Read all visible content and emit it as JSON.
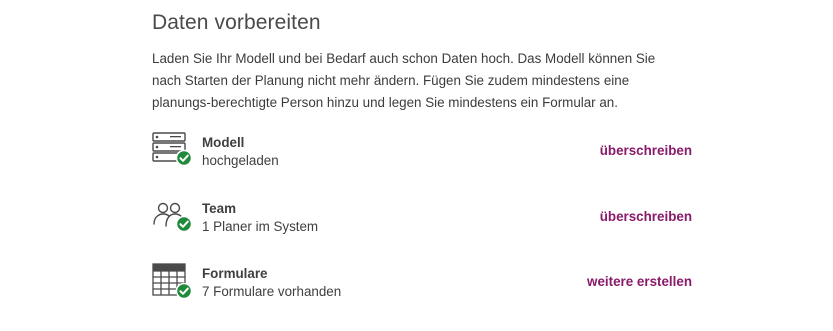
{
  "section": {
    "title": "Daten vorbereiten",
    "description": "Laden Sie Ihr Modell und bei Bedarf auch schon Daten hoch. Das Modell können Sie nach Starten der Planung nicht mehr ändern. Fügen Sie zudem mindestens eine planungs-berechtigte Person hinzu und legen Sie mindestens ein Formular an."
  },
  "rows": [
    {
      "icon": "server-icon",
      "status_icon": "check-icon",
      "title": "Modell",
      "subtitle": "hochgeladen",
      "action": "überschreiben"
    },
    {
      "icon": "team-icon",
      "status_icon": "check-icon",
      "title": "Team",
      "subtitle": "1 Planer im System",
      "action": "überschreiben"
    },
    {
      "icon": "table-icon",
      "status_icon": "check-icon",
      "title": "Formulare",
      "subtitle": "7 Formulare vorhanden",
      "action": "weitere erstellen"
    }
  ],
  "colors": {
    "accent": "#8a1a6a",
    "success": "#1f8a3a",
    "icon_stroke": "#4a4a4a"
  }
}
